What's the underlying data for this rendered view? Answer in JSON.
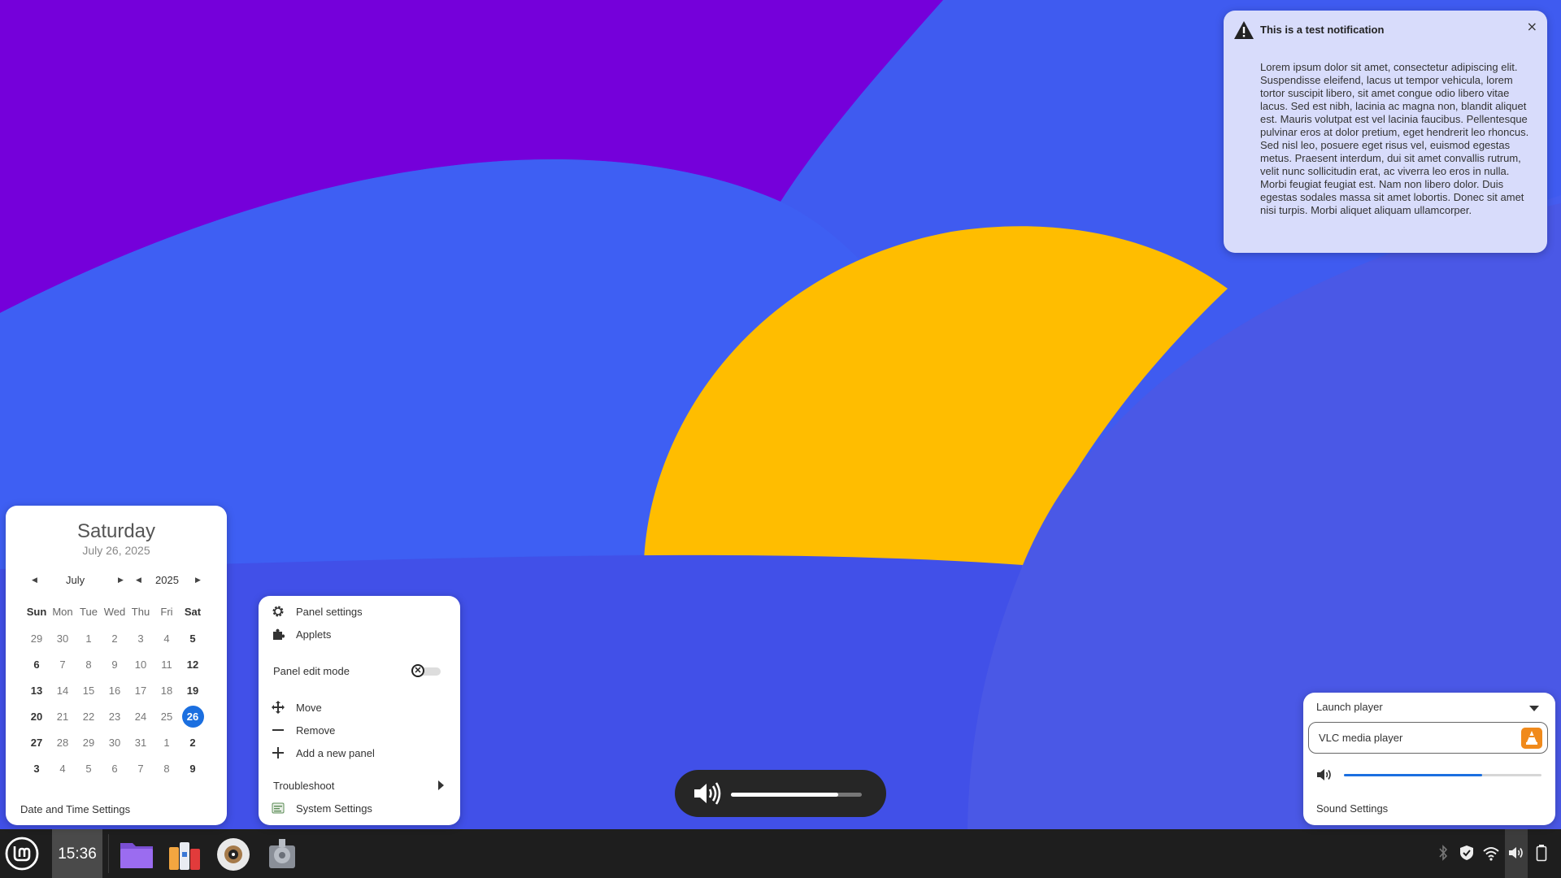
{
  "notification": {
    "title": "This is a test notification",
    "close": "×",
    "body": "Lorem ipsum dolor sit amet, consectetur adipiscing elit. Suspendisse eleifend, lacus ut tempor vehicula, lorem tortor suscipit libero, sit amet congue odio libero vitae lacus. Sed est nibh, lacinia ac magna non, blandit aliquet est. Mauris volutpat est vel lacinia faucibus. Pellentesque pulvinar eros at dolor pretium, eget hendrerit leo rhoncus. Sed nisl leo, posuere eget risus vel, euismod egestas metus. Praesent interdum, dui sit amet convallis rutrum, velit nunc sollicitudin erat, ac viverra leo eros in nulla. Morbi feugiat feugiat est. Nam non libero dolor. Duis egestas sodales massa sit amet lobortis. Donec sit amet nisi turpis. Morbi aliquet aliquam ullamcorper."
  },
  "calendar": {
    "weekday": "Saturday",
    "date": "July 26, 2025",
    "month": "July",
    "year": "2025",
    "headers": [
      "Sun",
      "Mon",
      "Tue",
      "Wed",
      "Thu",
      "Fri",
      "Sat"
    ],
    "weeks": [
      [
        "29",
        "30",
        "1",
        "2",
        "3",
        "4",
        "5"
      ],
      [
        "6",
        "7",
        "8",
        "9",
        "10",
        "11",
        "12"
      ],
      [
        "13",
        "14",
        "15",
        "16",
        "17",
        "18",
        "19"
      ],
      [
        "20",
        "21",
        "22",
        "23",
        "24",
        "25",
        "26"
      ],
      [
        "27",
        "28",
        "29",
        "30",
        "31",
        "1",
        "2"
      ],
      [
        "3",
        "4",
        "5",
        "6",
        "7",
        "8",
        "9"
      ]
    ],
    "selected_day": "26",
    "settings_label": "Date and Time Settings"
  },
  "panel_menu": {
    "panel_settings": "Panel settings",
    "applets": "Applets",
    "panel_edit_mode": "Panel edit mode",
    "panel_edit_mode_on": false,
    "move": "Move",
    "remove": "Remove",
    "add_panel": "Add a new panel",
    "troubleshoot": "Troubleshoot",
    "system_settings": "System Settings"
  },
  "osd": {
    "icon": "volume-high-icon",
    "level": 0.82
  },
  "sound": {
    "launch_player": "Launch player",
    "player_name": "VLC media player",
    "volume_level": 0.7,
    "settings_label": "Sound Settings"
  },
  "taskbar": {
    "clock": "15:36",
    "launchers": [
      "files-icon",
      "toolbox-icon",
      "media-player-icon",
      "settings-icon"
    ],
    "tray": [
      "bluetooth-icon",
      "shield-icon",
      "wifi-icon",
      "volume-icon",
      "battery-icon"
    ]
  },
  "colors": {
    "accent": "#1b6fe0",
    "wallpaper_purple": "#7500da",
    "wallpaper_blue": "#3f5bf0",
    "wallpaper_yellow": "#ffbd00",
    "taskbar": "#1e1e1e"
  }
}
